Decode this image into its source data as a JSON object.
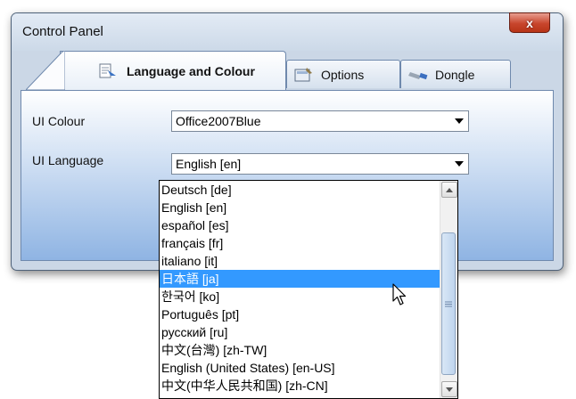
{
  "window": {
    "title": "Control Panel",
    "close_glyph": "x"
  },
  "tabs": [
    {
      "label": "Language and Colour",
      "icon": "language-icon",
      "active": true
    },
    {
      "label": "Options",
      "icon": "options-icon",
      "active": false
    },
    {
      "label": "Dongle",
      "icon": "dongle-icon",
      "active": false
    }
  ],
  "form": {
    "ui_colour_label": "UI Colour",
    "ui_colour_value": "Office2007Blue",
    "ui_language_label": "UI Language",
    "ui_language_value": "English [en]"
  },
  "language_dropdown": {
    "selected_index": 5,
    "options": [
      "Deutsch [de]",
      "English [en]",
      "español [es]",
      "français [fr]",
      "italiano [it]",
      "日本語 [ja]",
      "한국어 [ko]",
      "Português [pt]",
      "русский [ru]",
      "中文(台灣) [zh-TW]",
      "English (United States) [en-US]",
      "中文(中华人民共和国) [zh-CN]"
    ]
  },
  "colors": {
    "window_frame": "#cbd7e6",
    "close_button": "#c8452c",
    "selection": "#3399ff",
    "panel_gradient_bottom": "#8fb4e3"
  }
}
